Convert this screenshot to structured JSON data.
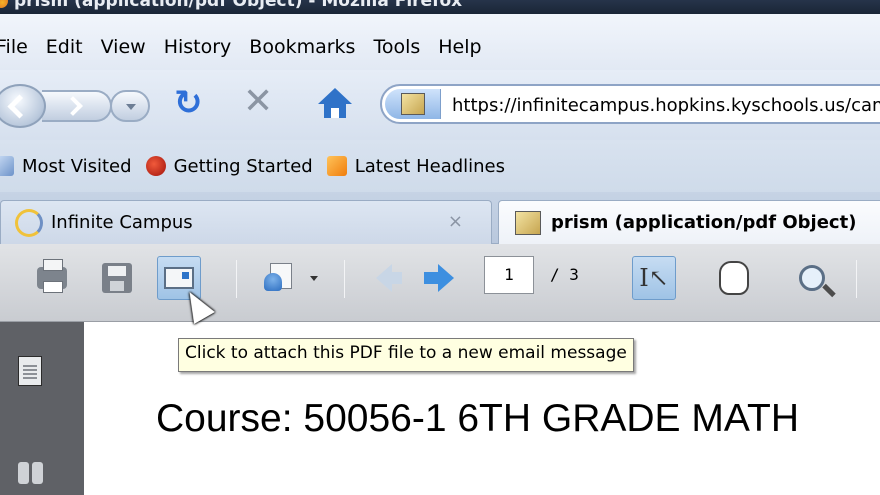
{
  "window": {
    "title": "prism (application/pdf Object) - Mozilla Firefox"
  },
  "menu": {
    "items": [
      {
        "label": "File"
      },
      {
        "label": "Edit"
      },
      {
        "label": "View"
      },
      {
        "label": "History"
      },
      {
        "label": "Bookmarks"
      },
      {
        "label": "Tools"
      },
      {
        "label": "Help"
      }
    ]
  },
  "navigation": {
    "url": "https://infinitecampus.hopkins.kyschools.us/campus/prism"
  },
  "bookmarks": {
    "items": [
      {
        "label": "Most Visited",
        "icon": "most-visited-icon"
      },
      {
        "label": "Getting Started",
        "icon": "getting-started-icon"
      },
      {
        "label": "Latest Headlines",
        "icon": "rss-feed-icon"
      }
    ]
  },
  "tabs": [
    {
      "label": "Infinite Campus",
      "active": false,
      "close": "×"
    },
    {
      "label": "prism (application/pdf Object)",
      "active": true
    }
  ],
  "pdf_toolbar": {
    "current_page": "1",
    "total_pages": "/ 3"
  },
  "tooltip": {
    "text": "Click to attach this PDF file to a new email message"
  },
  "document": {
    "title": "Course: 50056-1 6TH GRADE MATH"
  },
  "colors": {
    "titlebar": "#1f2c40",
    "tooltip_bg": "#ffffe1",
    "left_panel": "#5f6166",
    "selected_tool": "#a9cbea"
  }
}
